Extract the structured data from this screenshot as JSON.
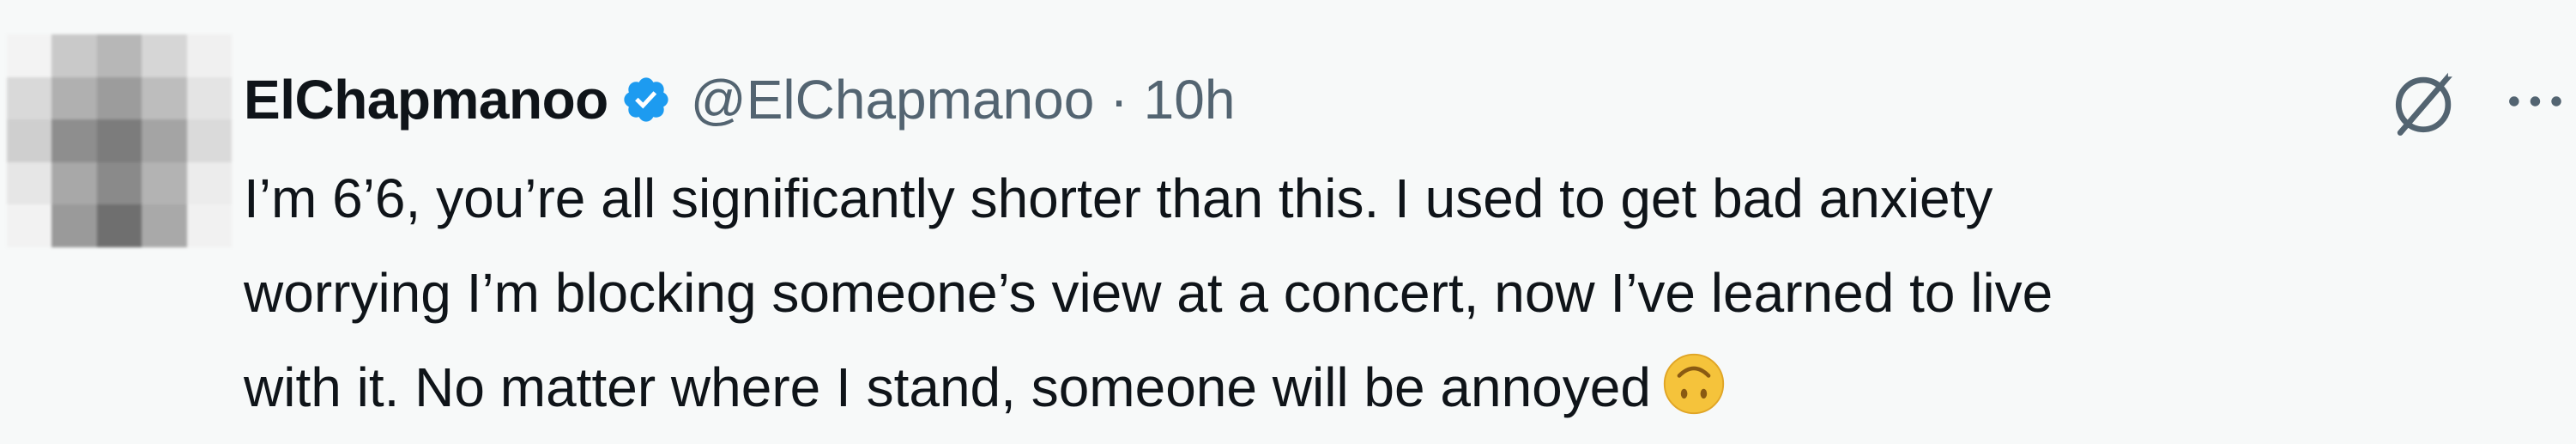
{
  "tweet": {
    "author": {
      "display_name": "ElChapmanoo",
      "handle": "@ElChapmanoo",
      "verified": true,
      "avatar_blurred": true
    },
    "separator": "·",
    "time": "10h",
    "text_lines": [
      "I’m 6’6, you’re all significantly shorter than this. I used to get bad anxiety",
      "worrying I’m blocking someone’s view at a concert, now I’ve learned to live",
      "with it. No matter where I stand, someone will be annoyed"
    ],
    "emoji": "upside-down-face"
  },
  "icons": {
    "verified": "verified-badge-icon",
    "grok": "grok-icon",
    "more": "more-options-icon"
  },
  "colors": {
    "background": "#f7f9f9",
    "text_primary": "#0f1419",
    "text_secondary": "#536471",
    "verified_blue": "#1d9bf0",
    "emoji_yellow": "#f5c33b"
  }
}
